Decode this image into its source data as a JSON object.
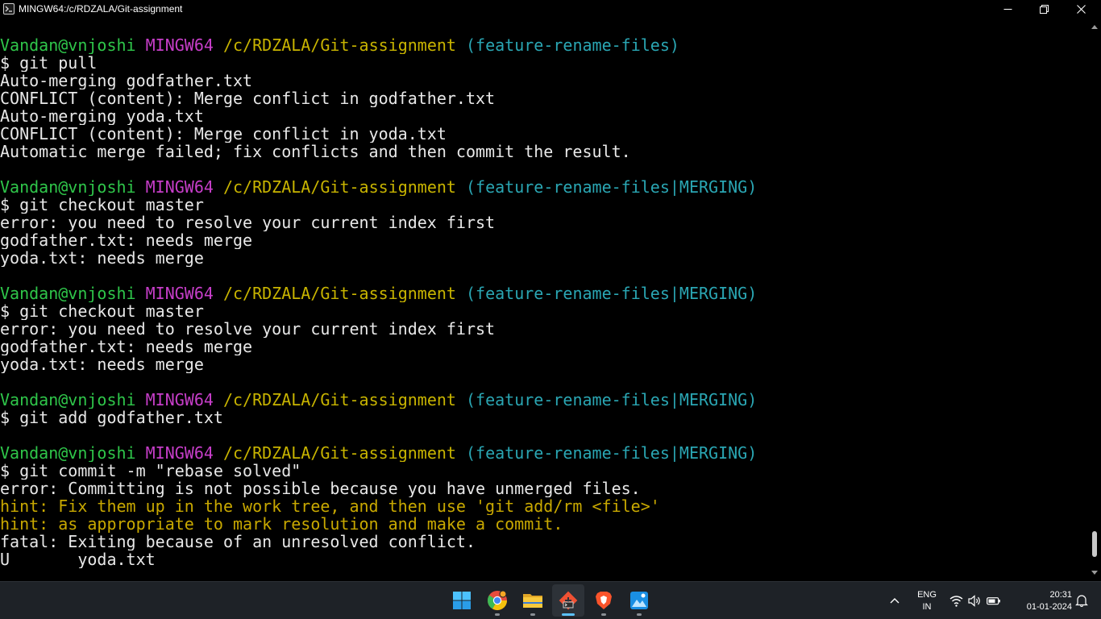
{
  "window": {
    "title": "MINGW64:/c/RDZALA/Git-assignment",
    "controls": {
      "minimize": "minimize-icon",
      "restore": "restore-icon",
      "close": "close-icon"
    }
  },
  "terminal": {
    "lines": [
      {
        "segments": [
          {
            "text": "Vandan@vnjoshi",
            "role": "user"
          },
          {
            "text": " "
          },
          {
            "text": "MINGW64",
            "role": "sys"
          },
          {
            "text": " "
          },
          {
            "text": "/c/RDZALA/Git-assignment",
            "role": "path"
          },
          {
            "text": " "
          },
          {
            "text": "(feature-rename-files)",
            "role": "branch"
          }
        ]
      },
      {
        "segments": [
          {
            "text": "$ git pull"
          }
        ]
      },
      {
        "segments": [
          {
            "text": "Auto-merging godfather.txt"
          }
        ]
      },
      {
        "segments": [
          {
            "text": "CONFLICT (content): Merge conflict in godfather.txt"
          }
        ]
      },
      {
        "segments": [
          {
            "text": "Auto-merging yoda.txt"
          }
        ]
      },
      {
        "segments": [
          {
            "text": "CONFLICT (content): Merge conflict in yoda.txt"
          }
        ]
      },
      {
        "segments": [
          {
            "text": "Automatic merge failed; fix conflicts and then commit the result."
          }
        ]
      },
      {
        "segments": [
          {
            "text": ""
          }
        ]
      },
      {
        "segments": [
          {
            "text": "Vandan@vnjoshi",
            "role": "user"
          },
          {
            "text": " "
          },
          {
            "text": "MINGW64",
            "role": "sys"
          },
          {
            "text": " "
          },
          {
            "text": "/c/RDZALA/Git-assignment",
            "role": "path"
          },
          {
            "text": " "
          },
          {
            "text": "(feature-rename-files|MERGING)",
            "role": "branch"
          }
        ]
      },
      {
        "segments": [
          {
            "text": "$ git checkout master"
          }
        ]
      },
      {
        "segments": [
          {
            "text": "error: you need to resolve your current index first"
          }
        ]
      },
      {
        "segments": [
          {
            "text": "godfather.txt: needs merge"
          }
        ]
      },
      {
        "segments": [
          {
            "text": "yoda.txt: needs merge"
          }
        ]
      },
      {
        "segments": [
          {
            "text": ""
          }
        ]
      },
      {
        "segments": [
          {
            "text": "Vandan@vnjoshi",
            "role": "user"
          },
          {
            "text": " "
          },
          {
            "text": "MINGW64",
            "role": "sys"
          },
          {
            "text": " "
          },
          {
            "text": "/c/RDZALA/Git-assignment",
            "role": "path"
          },
          {
            "text": " "
          },
          {
            "text": "(feature-rename-files|MERGING)",
            "role": "branch"
          }
        ]
      },
      {
        "segments": [
          {
            "text": "$ git checkout master"
          }
        ]
      },
      {
        "segments": [
          {
            "text": "error: you need to resolve your current index first"
          }
        ]
      },
      {
        "segments": [
          {
            "text": "godfather.txt: needs merge"
          }
        ]
      },
      {
        "segments": [
          {
            "text": "yoda.txt: needs merge"
          }
        ]
      },
      {
        "segments": [
          {
            "text": ""
          }
        ]
      },
      {
        "segments": [
          {
            "text": "Vandan@vnjoshi",
            "role": "user"
          },
          {
            "text": " "
          },
          {
            "text": "MINGW64",
            "role": "sys"
          },
          {
            "text": " "
          },
          {
            "text": "/c/RDZALA/Git-assignment",
            "role": "path"
          },
          {
            "text": " "
          },
          {
            "text": "(feature-rename-files|MERGING)",
            "role": "branch"
          }
        ]
      },
      {
        "segments": [
          {
            "text": "$ git add godfather.txt"
          }
        ]
      },
      {
        "segments": [
          {
            "text": ""
          }
        ]
      },
      {
        "segments": [
          {
            "text": "Vandan@vnjoshi",
            "role": "user"
          },
          {
            "text": " "
          },
          {
            "text": "MINGW64",
            "role": "sys"
          },
          {
            "text": " "
          },
          {
            "text": "/c/RDZALA/Git-assignment",
            "role": "path"
          },
          {
            "text": " "
          },
          {
            "text": "(feature-rename-files|MERGING)",
            "role": "branch"
          }
        ]
      },
      {
        "segments": [
          {
            "text": "$ git commit -m \"rebase solved\""
          }
        ]
      },
      {
        "segments": [
          {
            "text": "error: Committing is not possible because you have unmerged files."
          }
        ]
      },
      {
        "segments": [
          {
            "text": "hint: Fix them up in the work tree, and then use 'git add/rm <file>'",
            "role": "hint"
          }
        ]
      },
      {
        "segments": [
          {
            "text": "hint: as appropriate to mark resolution and make a commit.",
            "role": "hint"
          }
        ]
      },
      {
        "segments": [
          {
            "text": "fatal: Exiting because of an unresolved conflict."
          }
        ]
      },
      {
        "segments": [
          {
            "text": "U       yoda.txt"
          }
        ]
      }
    ]
  },
  "colors": {
    "user": "#2fc64a",
    "sys": "#c73ec9",
    "path": "#c8b400",
    "branch": "#2aa6b3",
    "hint": "#c8a800",
    "text": "#e8e8e8",
    "background": "#000000",
    "taskbar": "#1e2227",
    "active_indicator": "#5cc2ff"
  },
  "taskbar": {
    "apps": [
      {
        "name": "windows-start-icon",
        "active": false
      },
      {
        "name": "chrome-icon",
        "active": false
      },
      {
        "name": "file-explorer-icon",
        "active": false
      },
      {
        "name": "git-bash-icon",
        "active": true
      },
      {
        "name": "brave-browser-icon",
        "active": false
      },
      {
        "name": "photos-icon",
        "active": false
      }
    ],
    "tray": {
      "chevron": "chevron-up-icon",
      "language": "ENG",
      "region": "IN",
      "icons": [
        "wifi-icon",
        "volume-icon",
        "battery-icon"
      ],
      "time": "20:31",
      "date": "01-01-2024",
      "notification": "notification-bell-icon"
    }
  }
}
